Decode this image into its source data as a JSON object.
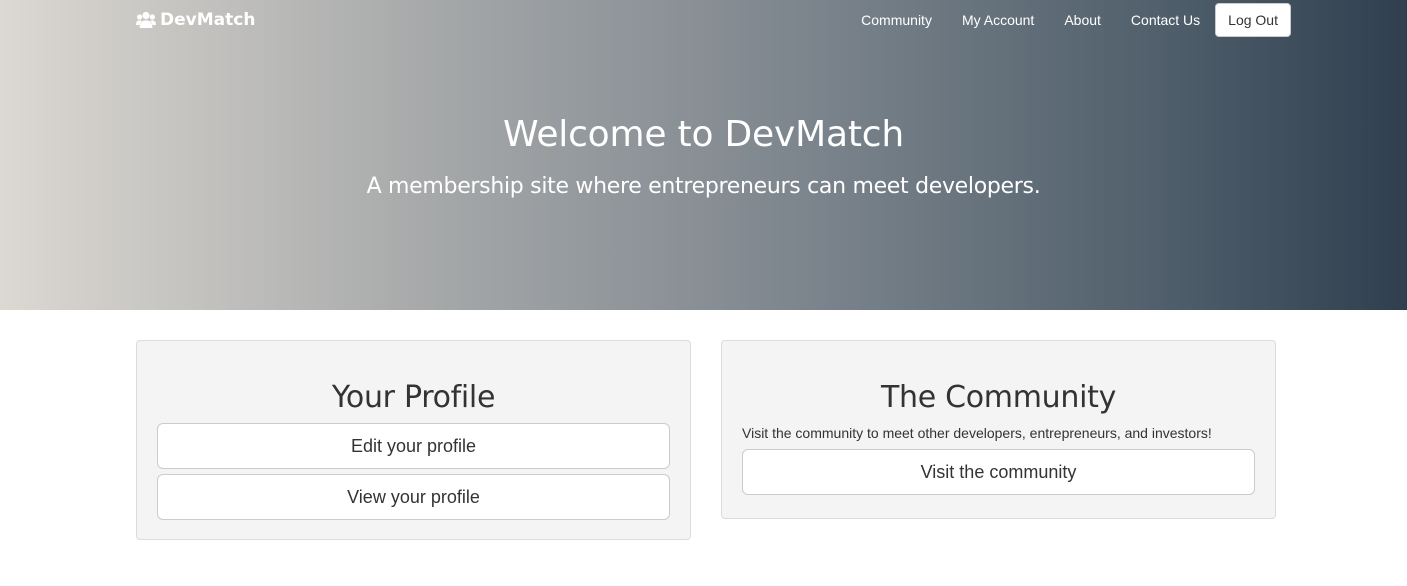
{
  "nav": {
    "brand": "DevMatch",
    "brand_icon": "users-icon",
    "links": [
      "Community",
      "My Account",
      "About",
      "Contact Us"
    ],
    "logout_label": "Log Out"
  },
  "hero": {
    "title": "Welcome to DevMatch",
    "subtitle": "A membership site where entrepreneurs can meet developers."
  },
  "profile_panel": {
    "title": "Your Profile",
    "buttons": [
      "Edit your profile",
      "View your profile"
    ]
  },
  "community_panel": {
    "title": "The Community",
    "text": "Visit the community to meet other developers, entrepreneurs, and investors!",
    "button": "Visit the community"
  },
  "colors": {
    "gradient_left": "#dcd8d2",
    "gradient_right": "#2f3f4f",
    "panel_background": "#f4f4f4"
  }
}
